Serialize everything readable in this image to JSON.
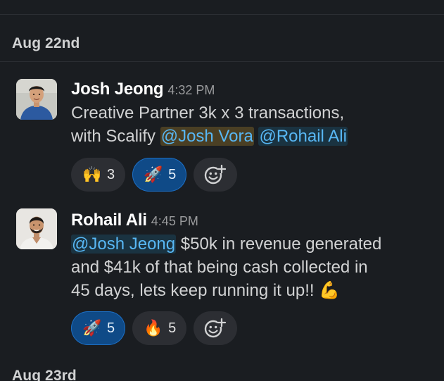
{
  "dates": {
    "first": "Aug 22nd",
    "second": "Aug 23rd"
  },
  "messages": [
    {
      "author": "Josh Jeong",
      "time": "4:32 PM",
      "text_line1": "Creative Partner  3k x 3 transactions,",
      "text_line2_prefix": "with Scalify ",
      "mention1": "@Josh Vora",
      "mention2": "@Rohail Ali",
      "reactions": [
        {
          "emoji": "🙌",
          "emoji_name": "raised-hands-icon",
          "count": "3",
          "active": false
        },
        {
          "emoji": "🚀",
          "emoji_name": "rocket-icon",
          "count": "5",
          "active": true
        }
      ]
    },
    {
      "author": "Rohail Ali",
      "time": "4:45 PM",
      "mention": "@Josh Jeong",
      "text_after_mention": " $50k in revenue generated",
      "text_line2": "and $41k of that being cash collected in",
      "text_line3": "45 days, lets keep running it up!! ",
      "trailing_emoji": "💪",
      "reactions": [
        {
          "emoji": "🚀",
          "emoji_name": "rocket-icon",
          "count": "5",
          "active": true
        },
        {
          "emoji": "🔥",
          "emoji_name": "fire-icon",
          "count": "5",
          "active": false
        }
      ]
    }
  ],
  "colors": {
    "background": "#1a1d21",
    "mention": "#58b7f4",
    "active_reaction": "#0f4a87"
  }
}
